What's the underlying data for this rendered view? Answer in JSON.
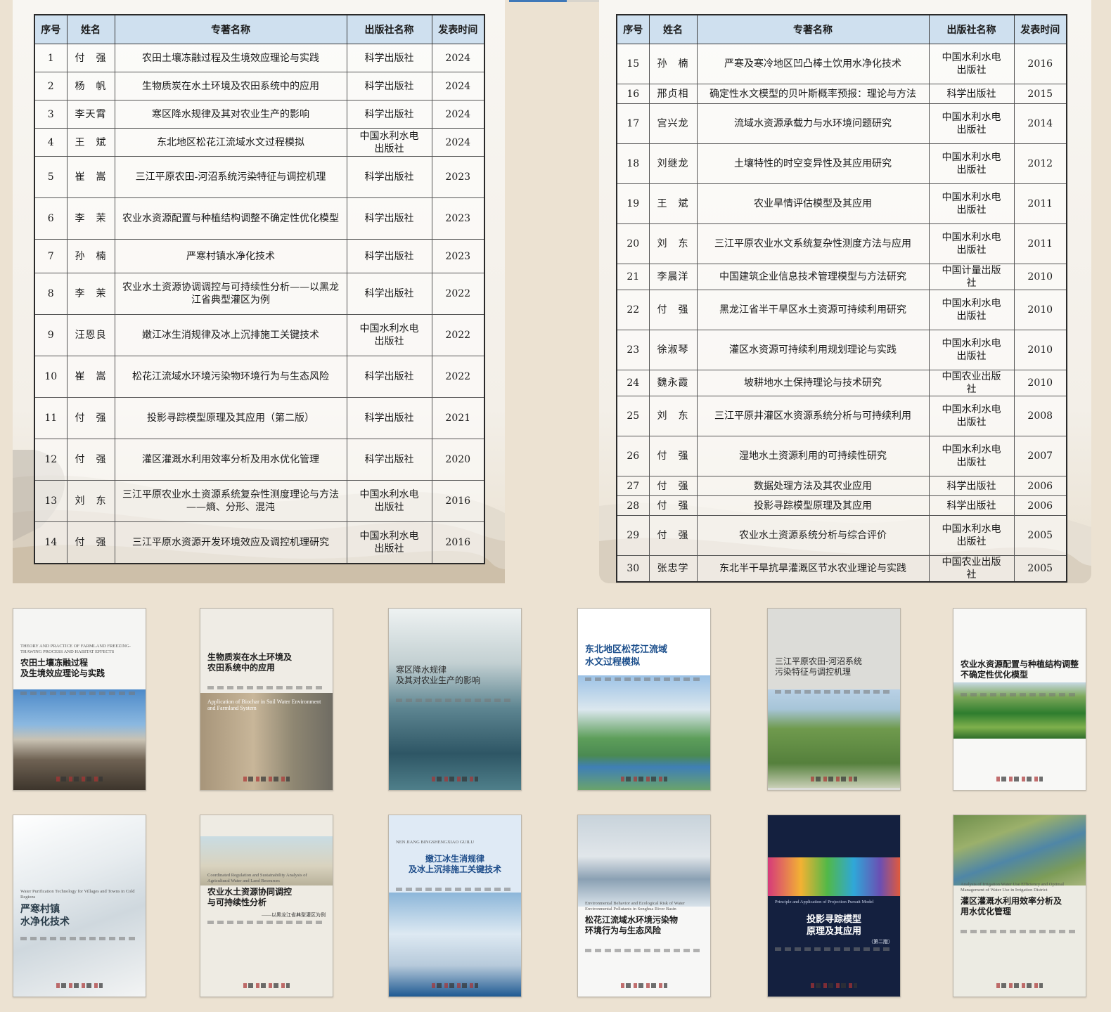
{
  "headers": [
    "序号",
    "姓名",
    "专著名称",
    "出版社名称",
    "发表时间"
  ],
  "left_rows": [
    [
      "1",
      "付　强",
      "农田土壤冻融过程及生境效应理论与实践",
      "科学出版社",
      "2024"
    ],
    [
      "2",
      "杨　帆",
      "生物质炭在水土环境及农田系统中的应用",
      "科学出版社",
      "2024"
    ],
    [
      "3",
      "李天霄",
      "寒区降水规律及其对农业生产的影响",
      "科学出版社",
      "2024"
    ],
    [
      "4",
      "王　斌",
      "东北地区松花江流域水文过程模拟",
      "中国水利水电出版社",
      "2024"
    ],
    [
      "5",
      "崔　嵩",
      "三江平原农田-河沼系统污染特征与调控机理",
      "科学出版社",
      "2023"
    ],
    [
      "6",
      "李　茉",
      "农业水资源配置与种植结构调整不确定性优化模型",
      "科学出版社",
      "2023"
    ],
    [
      "7",
      "孙　楠",
      "严寒村镇水净化技术",
      "科学出版社",
      "2023"
    ],
    [
      "8",
      "李　茉",
      "农业水土资源协调调控与可持续性分析——以黑龙江省典型灌区为例",
      "科学出版社",
      "2022"
    ],
    [
      "9",
      "汪恩良",
      "嫩江冰生消规律及冰上沉排施工关键技术",
      "中国水利水电出版社",
      "2022"
    ],
    [
      "10",
      "崔　嵩",
      "松花江流域水环境污染物环境行为与生态风险",
      "科学出版社",
      "2022"
    ],
    [
      "11",
      "付　强",
      "投影寻踪模型原理及其应用（第二版）",
      "科学出版社",
      "2021"
    ],
    [
      "12",
      "付　强",
      "灌区灌溉水利用效率分析及用水优化管理",
      "科学出版社",
      "2020"
    ],
    [
      "13",
      "刘　东",
      "三江平原农业水土资源系统复杂性测度理论与方法——熵、分形、混沌",
      "中国水利水电出版社",
      "2016"
    ],
    [
      "14",
      "付　强",
      "三江平原水资源开发环境效应及调控机理研究",
      "中国水利水电出版社",
      "2016"
    ]
  ],
  "right_rows": [
    [
      "15",
      "孙　楠",
      "严寒及寒冷地区凹凸棒土饮用水净化技术",
      "中国水利水电出版社",
      "2016"
    ],
    [
      "16",
      "邢贞相",
      "确定性水文模型的贝叶斯概率预报：理论与方法",
      "科学出版社",
      "2015"
    ],
    [
      "17",
      "宫兴龙",
      "流域水资源承载力与水环境问题研究",
      "中国水利水电出版社",
      "2014"
    ],
    [
      "18",
      "刘继龙",
      "土壤特性的时空变异性及其应用研究",
      "中国水利水电出版社",
      "2012"
    ],
    [
      "19",
      "王　斌",
      "农业旱情评估模型及其应用",
      "中国水利水电出版社",
      "2011"
    ],
    [
      "20",
      "刘　东",
      "三江平原农业水文系统复杂性测度方法与应用",
      "中国水利水电出版社",
      "2011"
    ],
    [
      "21",
      "李晨洋",
      "中国建筑企业信息技术管理模型与方法研究",
      "中国计量出版社",
      "2010"
    ],
    [
      "22",
      "付　强",
      "黑龙江省半干旱区水土资源可持续利用研究",
      "中国水利水电出版社",
      "2010"
    ],
    [
      "23",
      "徐淑琴",
      "灌区水资源可持续利用规划理论与实践",
      "中国水利水电出版社",
      "2010"
    ],
    [
      "24",
      "魏永霞",
      "坡耕地水土保持理论与技术研究",
      "中国农业出版社",
      "2010"
    ],
    [
      "25",
      "刘　东",
      "三江平原井灌区水资源系统分析与可持续利用",
      "中国水利水电出版社",
      "2008"
    ],
    [
      "26",
      "付　强",
      "湿地水土资源利用的可持续性研究",
      "中国水利水电出版社",
      "2007"
    ],
    [
      "27",
      "付　强",
      "数据处理方法及其农业应用",
      "科学出版社",
      "2006"
    ],
    [
      "28",
      "付　强",
      "投影寻踪模型原理及其应用",
      "科学出版社",
      "2006"
    ],
    [
      "29",
      "付　强",
      "农业水土资源系统分析与综合评价",
      "中国水利水电出版社",
      "2005"
    ],
    [
      "30",
      "张忠学",
      "东北半干旱抗旱灌溉区节水农业理论与实践",
      "中国农业出版社",
      "2005"
    ]
  ],
  "covers": [
    {
      "title": "农田土壤冻融过程\n及生境效应理论与实践",
      "eng": "THEORY AND PRACTICE OF FARMLAND FREEZING-THAWING PROCESS AND HABITAT EFFECTS",
      "style": "field"
    },
    {
      "title": "生物质炭在水土环境及\n农田系统中的应用",
      "eng": "Application of Biochar in Soil Water Environment and Farmland System",
      "style": "biochar"
    },
    {
      "title": "寒区降水规律\n及其对农业生产的影响",
      "eng": "",
      "style": "rain"
    },
    {
      "title": "东北地区松花江流域\n水文过程模拟",
      "eng": "",
      "style": "river"
    },
    {
      "title": "三江平原农田-河沼系统\n污染特征与调控机理",
      "eng": "",
      "style": "wetland"
    },
    {
      "title": "农业水资源配置与种植结构调整\n不确定性优化模型",
      "eng": "",
      "style": "green"
    },
    {
      "title": "严寒村镇\n水净化技术",
      "eng": "Water Purification Technology for Villages and Towns in Cold Regions",
      "style": "frost"
    },
    {
      "title": "农业水土资源协同调控\n与可持续性分析",
      "eng": "Coordinated Regulation and Sustainability Analysis of Agricultural Water and Land Resources",
      "subtitle": "——以黑龙江省典型灌区为例",
      "style": "marsh"
    },
    {
      "title": "嫩江冰生消规律\n及冰上沉排施工关键技术",
      "eng": "NEN JIANG BINGSHENGXIAO GUILU",
      "style": "ice"
    },
    {
      "title": "松花江流域水环境污染物\n环境行为与生态风险",
      "eng": "Environmental Behavior and Ecological Risk of Water Environmental Pollutants in Songhua River Basin",
      "style": "city"
    },
    {
      "title": "投影寻踪模型\n原理及其应用",
      "eng": "Principle and Application of Projection Pursuit Model",
      "subtitle": "（第二版）",
      "style": "navy"
    },
    {
      "title": "灌区灌溉水利用效率分析及\n用水优化管理",
      "eng": "Analysis of Irrigation Water Use Efficiency and Optimal Management of Water Use in Irrigation District",
      "style": "terrace"
    }
  ]
}
